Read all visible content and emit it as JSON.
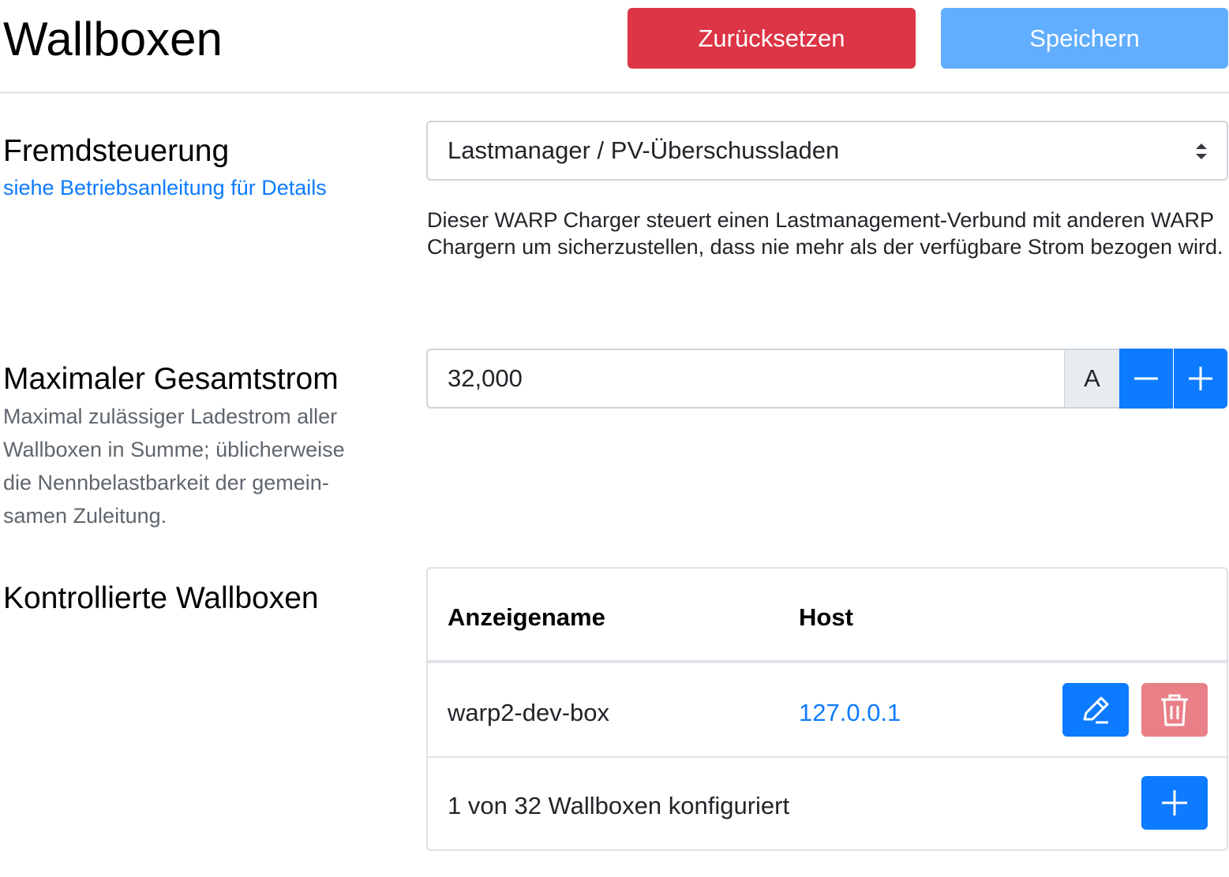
{
  "header": {
    "title": "Wallboxen",
    "reset_label": "Zurücksetzen",
    "save_label": "Speichern"
  },
  "fremdsteuerung": {
    "label": "Fremdsteuerung",
    "help_link": "siehe Betriebsanleitung für Details",
    "selected_option": "Lastmanager / PV-Überschussladen",
    "description": "Dieser WARP Charger steuert einen Lastmanagement-Verbund mit anderen WARP Chargern um sicherzustellen, dass nie mehr als der verfügbare Strom bezogen wird."
  },
  "max_current": {
    "label": "Maximaler Gesamtstrom",
    "help": "Maximal zulässiger Ladestrom aller Wallboxen in Summe; üblicherweise die Nennbelastbarkeit der gemein­samen Zuleitung.",
    "value": "32,000",
    "unit": "A"
  },
  "controlled": {
    "label": "Kontrollierte Wallboxen",
    "columns": [
      "Anzeigename",
      "Host"
    ],
    "rows": [
      {
        "name": "warp2-dev-box",
        "host": "127.0.0.1"
      }
    ],
    "footer": "1 von 32 Wallboxen konfiguriert"
  },
  "icons": {
    "edit": "pencil-icon",
    "delete": "trash-icon",
    "add": "plus-icon",
    "minus": "minus-icon",
    "select": "select-arrows-icon"
  },
  "colors": {
    "primary": "#0d7bff",
    "danger": "#dc3545",
    "danger_light": "#e97f87",
    "primary_light": "#61aeff",
    "link": "#0d7bff"
  }
}
